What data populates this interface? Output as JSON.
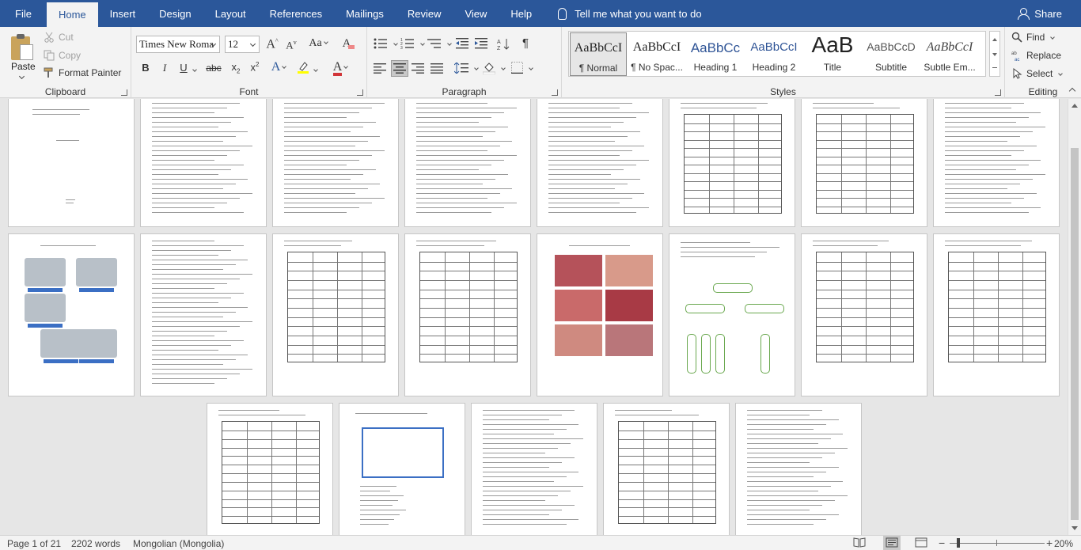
{
  "tabs": [
    {
      "label": "File"
    },
    {
      "label": "Home"
    },
    {
      "label": "Insert"
    },
    {
      "label": "Design"
    },
    {
      "label": "Layout"
    },
    {
      "label": "References"
    },
    {
      "label": "Mailings"
    },
    {
      "label": "Review"
    },
    {
      "label": "View"
    },
    {
      "label": "Help"
    }
  ],
  "tell_me": "Tell me what you want to do",
  "share": "Share",
  "clipboard": {
    "label": "Clipboard",
    "paste": "Paste",
    "cut": "Cut",
    "copy": "Copy",
    "format_painter": "Format Painter"
  },
  "font": {
    "label": "Font",
    "name": "Times New Roma",
    "size": "12",
    "grow": "A",
    "shrink": "A",
    "case": "Aa",
    "clear": "A",
    "bold": "B",
    "italic": "I",
    "underline": "U",
    "strike": "abc",
    "sub": "x",
    "sup": "x",
    "effects": "A",
    "highlight": "ab",
    "color": "A"
  },
  "paragraph": {
    "label": "Paragraph",
    "pilcrow": "¶"
  },
  "styles": {
    "label": "Styles",
    "items": [
      {
        "preview": "AaBbCcI",
        "name": "¶ Normal"
      },
      {
        "preview": "AaBbCcI",
        "name": "¶ No Spac..."
      },
      {
        "preview": "AaBbCc",
        "name": "Heading 1"
      },
      {
        "preview": "AaBbCcI",
        "name": "Heading 2"
      },
      {
        "preview": "AaB",
        "name": "Title"
      },
      {
        "preview": "AaBbCcD",
        "name": "Subtitle"
      },
      {
        "preview": "AaBbCcI",
        "name": "Subtle Em..."
      }
    ]
  },
  "editing": {
    "label": "Editing",
    "find": "Find",
    "replace": "Replace",
    "select": "Select"
  },
  "status": {
    "page": "Page 1 of 21",
    "words": "2202 words",
    "language": "Mongolian (Mongolia)",
    "zoom": "20%"
  },
  "colors": {
    "accent": "#2b579a",
    "font_color": "#d13438",
    "highlight": "#ffff00",
    "style_blue": "#2f5496"
  }
}
